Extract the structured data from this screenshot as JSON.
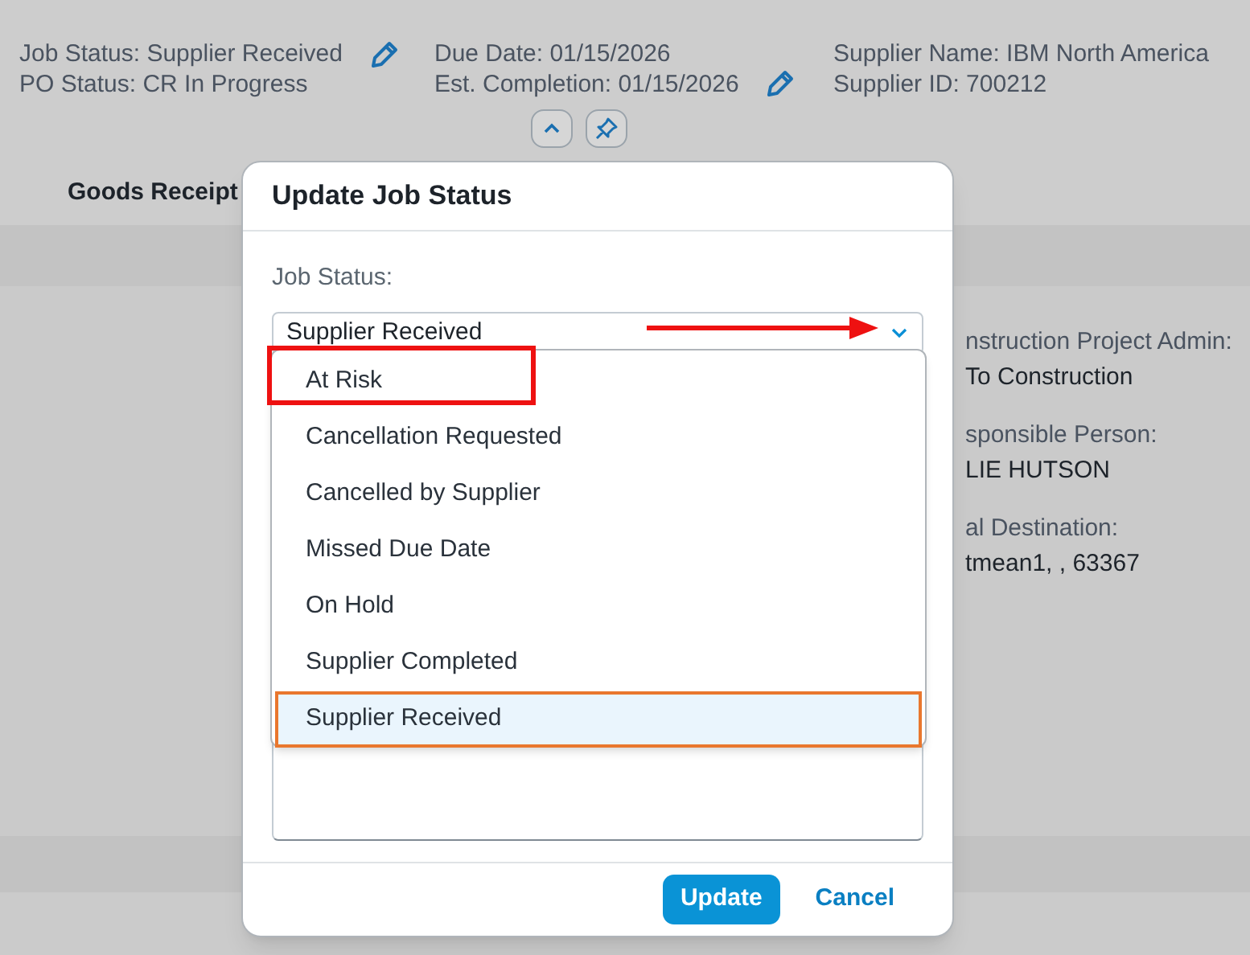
{
  "header": {
    "columns": [
      {
        "lines": [
          "Job Status: Supplier Received",
          "PO Status: CR In Progress"
        ],
        "editable": true
      },
      {
        "lines": [
          "Due Date: 01/15/2026",
          "Est. Completion: 01/15/2026"
        ],
        "editable": true
      },
      {
        "lines": [
          "Supplier Name: IBM North America",
          "Supplier ID: 700212"
        ],
        "editable": false
      }
    ]
  },
  "tabs": [
    {
      "label": "Goods Receipt",
      "selected": true
    }
  ],
  "details": [
    {
      "label": "nstruction Project Admin:",
      "value": "To Construction"
    },
    {
      "label": "sponsible Person:",
      "value": "LIE HUTSON"
    },
    {
      "label": "al Destination:",
      "value": "tmean1, , 63367"
    }
  ],
  "dialog": {
    "title": "Update Job Status",
    "field_label": "Job Status:",
    "value": "Supplier Received",
    "options": [
      {
        "label": "At Risk",
        "selected": false,
        "annotated": true
      },
      {
        "label": "Cancellation Requested",
        "selected": false,
        "annotated": false
      },
      {
        "label": "Cancelled by Supplier",
        "selected": false,
        "annotated": false
      },
      {
        "label": "Missed Due Date",
        "selected": false,
        "annotated": false
      },
      {
        "label": "On Hold",
        "selected": false,
        "annotated": false
      },
      {
        "label": "Supplier Completed",
        "selected": false,
        "annotated": false
      },
      {
        "label": "Supplier Received",
        "selected": true,
        "annotated": false
      }
    ],
    "buttons": [
      {
        "label": "Update",
        "kind": "primary"
      },
      {
        "label": "Cancel",
        "kind": "link"
      }
    ]
  }
}
